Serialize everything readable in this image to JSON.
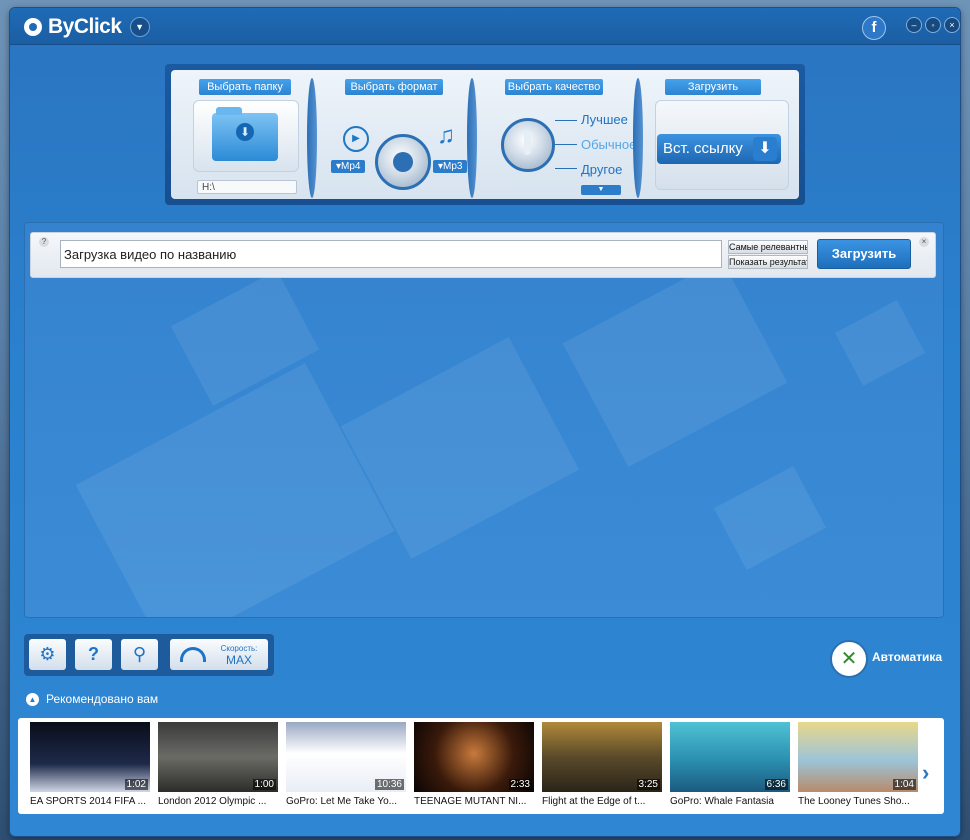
{
  "app": {
    "title": "ByClick"
  },
  "header": {
    "facebook_label": "f",
    "minimize": "–",
    "restore": "◦",
    "close": "×"
  },
  "panel": {
    "folder_label": "Выбрать папку",
    "folder_path": "H:\\",
    "format_label": "Выбрать формат",
    "format_video": "Mp4",
    "format_audio": "Mp3",
    "quality_label": "Выбрать качество",
    "quality_options": [
      "Лучшее",
      "Обычное",
      "Другое"
    ],
    "download_label": "Загрузить",
    "paste_link": "Вст. ссылку"
  },
  "search": {
    "help": "?",
    "input_value": "Загрузка видео по названию",
    "sort_options": [
      "Самые релевантны",
      "Показать результат"
    ],
    "submit": "Загрузить",
    "close": "×"
  },
  "toolbar": {
    "speed_label": "Скорость:",
    "speed_value": "MAX"
  },
  "automatic": {
    "label": "Автоматика"
  },
  "recommended": {
    "title": "Рекомендовано вам",
    "videos": [
      {
        "title": "EA SPORTS 2014 FIFA ...",
        "duration": "1:02"
      },
      {
        "title": "London 2012 Olympic ...",
        "duration": "1:00"
      },
      {
        "title": "GoPro: Let Me Take Yo...",
        "duration": "10:36"
      },
      {
        "title": "TEENAGE MUTANT NI...",
        "duration": "2:33"
      },
      {
        "title": "Flight at the Edge of t...",
        "duration": "3:25"
      },
      {
        "title": "GoPro: Whale Fantasia",
        "duration": "6:36"
      },
      {
        "title": "The Looney Tunes Sho...",
        "duration": "1:04"
      }
    ]
  },
  "colors": {
    "window": "#2a82cf",
    "titlebar": "#1b5ea3",
    "accent": "#2b7dcb"
  }
}
